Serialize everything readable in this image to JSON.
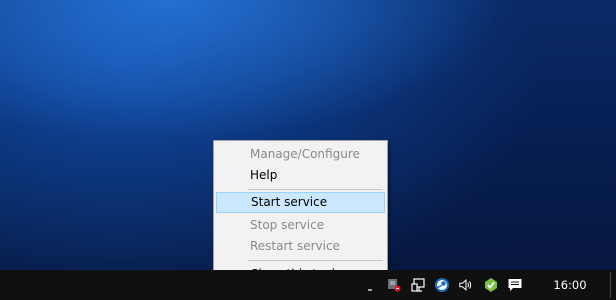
{
  "menu": {
    "items": [
      {
        "label": "Manage/Configure",
        "enabled": false
      },
      {
        "label": "Help",
        "enabled": true
      },
      {
        "label": "Start service",
        "enabled": true,
        "highlighted": true
      },
      {
        "label": "Stop service",
        "enabled": false
      },
      {
        "label": "Restart service",
        "enabled": false
      },
      {
        "label": "Close this tool",
        "enabled": true
      }
    ]
  },
  "taskbar": {
    "clock": "16:00",
    "tray_icons": [
      "service-tray-icon",
      "network-icon",
      "steam-icon",
      "volume-icon",
      "update-icon",
      "action-center-icon"
    ]
  },
  "colors": {
    "menu_background": "#f2f2f2",
    "menu_highlight": "#cce8ff",
    "menu_highlight_border": "#99d1ff",
    "disabled_text": "#8a8a8a",
    "taskbar": "#101010"
  }
}
